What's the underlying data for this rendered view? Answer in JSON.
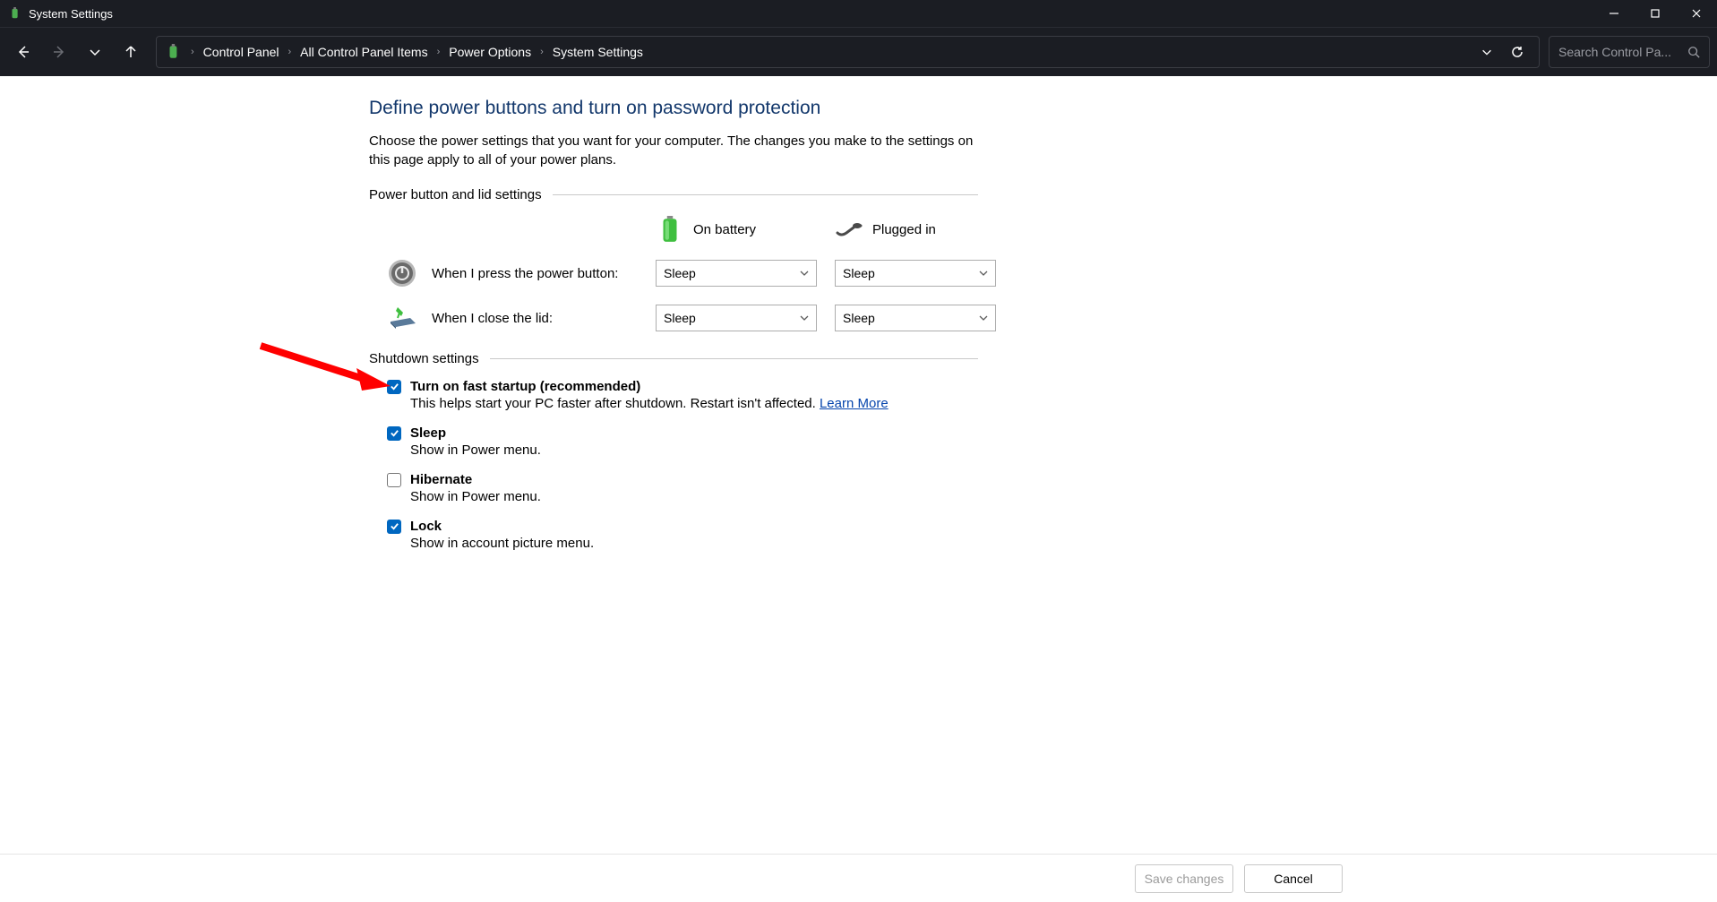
{
  "window": {
    "title": "System Settings"
  },
  "breadcrumb": {
    "items": [
      "Control Panel",
      "All Control Panel Items",
      "Power Options",
      "System Settings"
    ]
  },
  "search": {
    "placeholder": "Search Control Pa..."
  },
  "page": {
    "title": "Define power buttons and turn on password protection",
    "description": "Choose the power settings that you want for your computer. The changes you make to the settings on this page apply to all of your power plans."
  },
  "power_section": {
    "header": "Power button and lid settings",
    "col_battery": "On battery",
    "col_plugged": "Plugged in",
    "rows": [
      {
        "label": "When I press the power button:",
        "battery": "Sleep",
        "plugged": "Sleep"
      },
      {
        "label": "When I close the lid:",
        "battery": "Sleep",
        "plugged": "Sleep"
      }
    ]
  },
  "shutdown_section": {
    "header": "Shutdown settings",
    "items": [
      {
        "checked": true,
        "label": "Turn on fast startup (recommended)",
        "desc": "This helps start your PC faster after shutdown. Restart isn't affected. ",
        "link": "Learn More"
      },
      {
        "checked": true,
        "label": "Sleep",
        "desc": "Show in Power menu."
      },
      {
        "checked": false,
        "label": "Hibernate",
        "desc": "Show in Power menu."
      },
      {
        "checked": true,
        "label": "Lock",
        "desc": "Show in account picture menu."
      }
    ]
  },
  "footer": {
    "save": "Save changes",
    "cancel": "Cancel"
  }
}
